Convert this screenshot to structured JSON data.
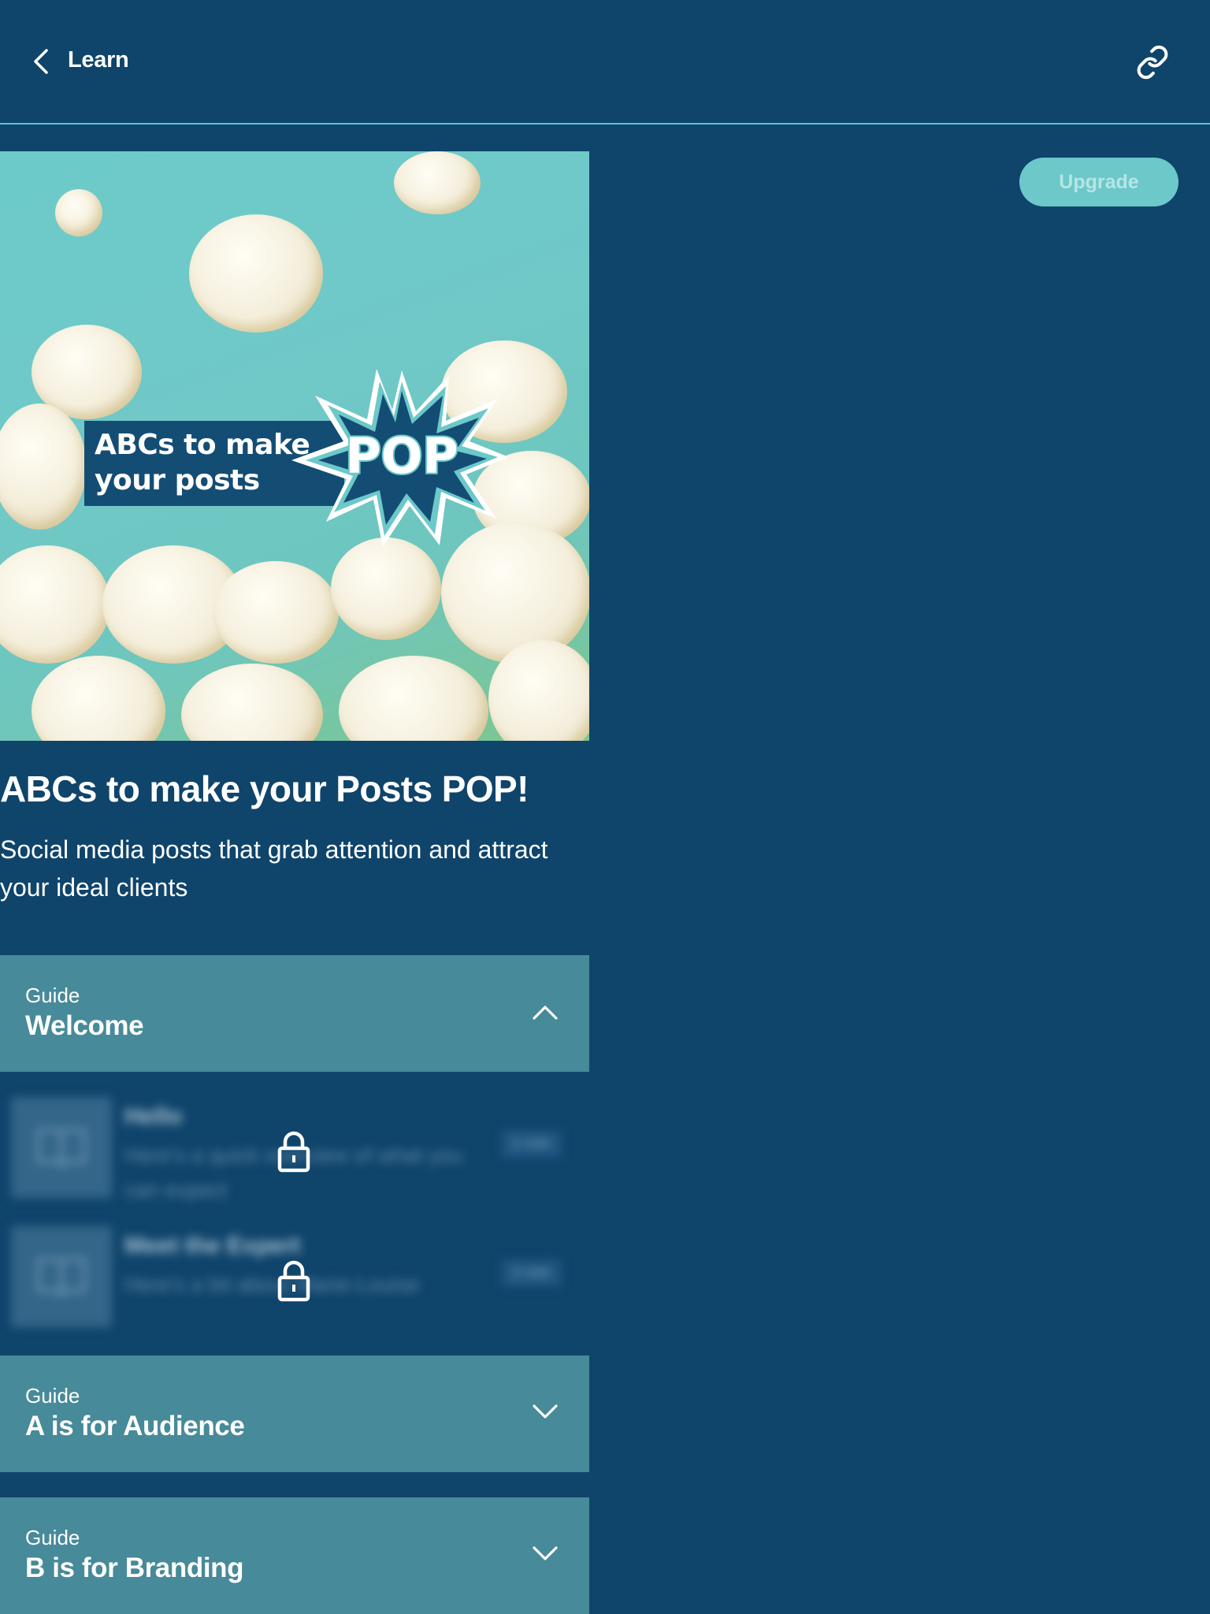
{
  "header": {
    "back_label": "Learn",
    "back_icon": "chevron-left-icon",
    "share_icon": "link-icon"
  },
  "upgrade": {
    "label": "Upgrade"
  },
  "hero": {
    "banner_line1": "ABCs to make",
    "banner_line2": "your posts",
    "burst_text": "POP"
  },
  "course": {
    "title": "ABCs to make your Posts POP!",
    "subtitle": "Social media posts that grab attention and attract your ideal clients"
  },
  "sections": [
    {
      "kicker": "Guide",
      "title": "Welcome",
      "expanded": true,
      "lessons": [
        {
          "name": "Hello",
          "description": "Here's a quick overview of what you can expect",
          "duration": "2 min",
          "locked": true
        },
        {
          "name": "Meet the Expert",
          "description": "Here's a bit about Marie-Louise",
          "duration": "2 min",
          "locked": true
        }
      ]
    },
    {
      "kicker": "Guide",
      "title": "A is for Audience",
      "expanded": false
    },
    {
      "kicker": "Guide",
      "title": "B is for Branding",
      "expanded": false
    }
  ],
  "colors": {
    "background": "#0f446b",
    "accent": "#5ec3cb",
    "section_bg": "#478a99",
    "upgrade_bg": "#6cc8c9"
  }
}
